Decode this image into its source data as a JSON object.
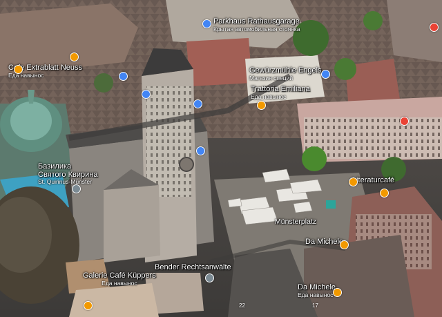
{
  "map": {
    "view": "3d-satellite",
    "places": [
      {
        "id": "parkhaus",
        "name": "Parkhaus Rathausgarage",
        "sub": "Крытая автомобильная стоянка",
        "icon": "parking-icon",
        "color": "#4285f4"
      },
      {
        "id": "gewurz",
        "name": "Gewürzmühle Engels",
        "sub": "Магазин специй",
        "icon": "shop-icon",
        "color": "#4285f4"
      },
      {
        "id": "trattoria",
        "name": "Trattoria Emiliana",
        "sub": "Еда навынос",
        "icon": "restaurant-icon",
        "color": "#f29900"
      },
      {
        "id": "extrablatt",
        "name": "Cafe Extrablatt Neuss",
        "sub": "Еда навынос",
        "icon": "restaurant-icon",
        "color": "#f29900"
      },
      {
        "id": "basilika",
        "name": "Базилика Святого Квирина",
        "name_line1": "Базилика",
        "name_line2": "Святого Квирина",
        "sub": "St. Quirinus-Münster",
        "icon": "church-icon",
        "color": "#7b8a93"
      },
      {
        "id": "literatur",
        "name": "Literaturcafé",
        "icon": "restaurant-icon",
        "color": "#f29900"
      },
      {
        "id": "munster",
        "name": "Münsterplatz"
      },
      {
        "id": "michele1",
        "name": "Da Michele",
        "icon": "restaurant-icon",
        "color": "#f29900"
      },
      {
        "id": "michele2",
        "name": "Da Michele",
        "sub": "Еда навынос",
        "icon": "restaurant-icon",
        "color": "#f29900"
      },
      {
        "id": "bender",
        "name": "Bender Rechtsanwälte",
        "icon": "place-icon",
        "color": "#7b8a93"
      },
      {
        "id": "kuppers",
        "name": "Galerie Café Küppers",
        "sub": "Еда навынос",
        "icon": "restaurant-icon",
        "color": "#f29900"
      }
    ],
    "numbers": [
      "22",
      "17"
    ]
  }
}
